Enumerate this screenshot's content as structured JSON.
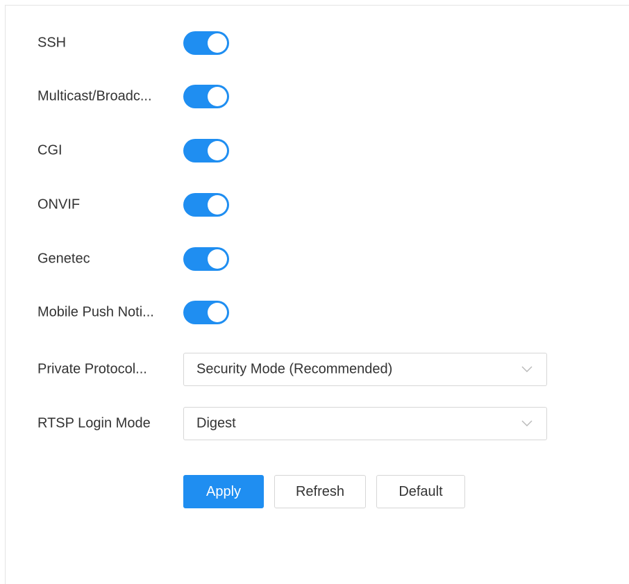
{
  "settings": {
    "toggles": [
      {
        "label": "SSH",
        "state": "on"
      },
      {
        "label": "Multicast/Broadc...",
        "state": "on"
      },
      {
        "label": "CGI",
        "state": "on"
      },
      {
        "label": "ONVIF",
        "state": "on"
      },
      {
        "label": "Genetec",
        "state": "on"
      },
      {
        "label": "Mobile Push Noti...",
        "state": "on"
      }
    ],
    "private_protocol": {
      "label": "Private Protocol...",
      "value": "Security Mode (Recommended)",
      "icon": "chevron-down-icon"
    },
    "rtsp_login_mode": {
      "label": "RTSP Login Mode",
      "value": "Digest",
      "icon": "chevron-down-icon"
    }
  },
  "actions": {
    "apply_label": "Apply",
    "refresh_label": "Refresh",
    "default_label": "Default"
  },
  "colors": {
    "accent": "#1f8ef1",
    "text": "#333333",
    "border": "#d6d6d6"
  }
}
